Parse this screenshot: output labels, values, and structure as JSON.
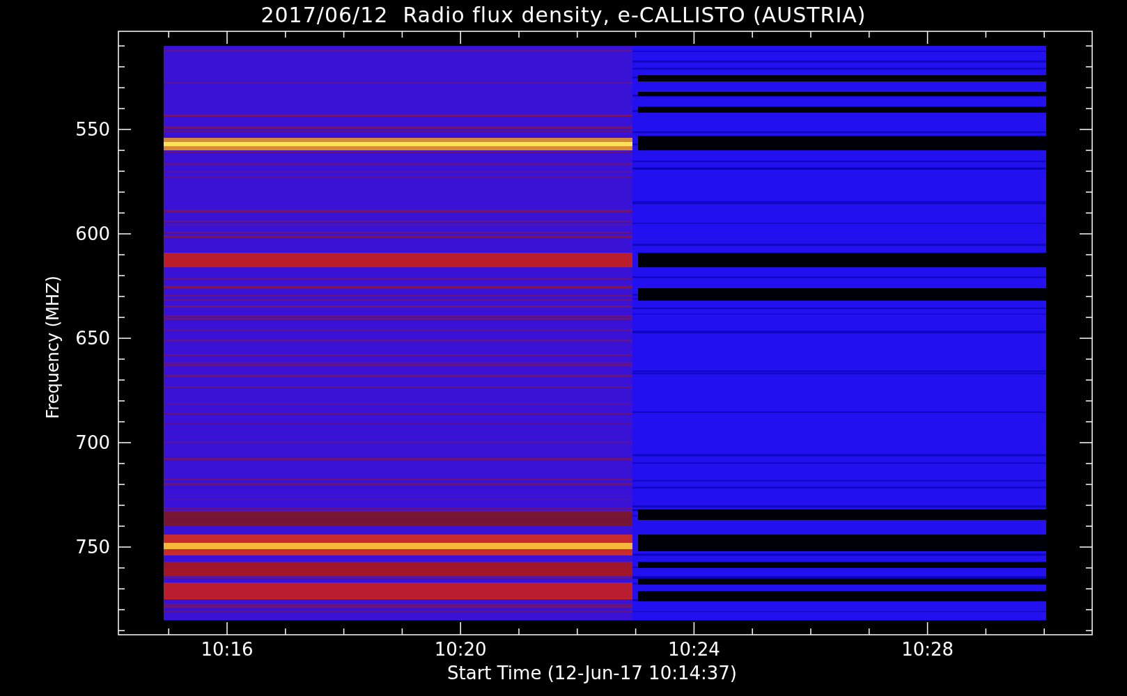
{
  "title": "2017/06/12  Radio flux density, e-CALLISTO (AUSTRIA)",
  "y_axis": {
    "label": "Frequency (MHZ)",
    "ticks": [
      "550",
      "600",
      "650",
      "700",
      "750"
    ]
  },
  "x_axis": {
    "label": "Start Time (12-Jun-17 10:14:37)",
    "ticks": [
      "10:16",
      "10:20",
      "10:24",
      "10:28"
    ]
  }
}
